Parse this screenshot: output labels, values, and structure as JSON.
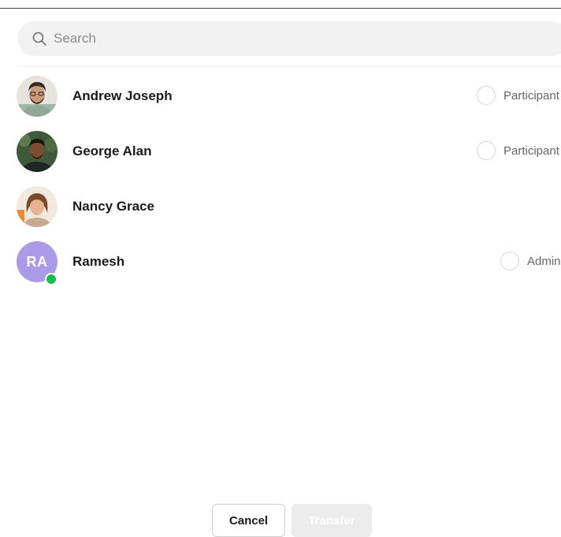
{
  "search": {
    "placeholder": "Search",
    "value": ""
  },
  "members": [
    {
      "name": "Andrew Joseph",
      "avatar": "photo-andrew",
      "role": "Participant",
      "role_selected": false
    },
    {
      "name": "George Alan",
      "avatar": "photo-george",
      "role": "Participant",
      "role_selected": false
    },
    {
      "name": "Nancy Grace",
      "avatar": "photo-nancy",
      "role": "",
      "role_selected": false
    },
    {
      "name": "Ramesh",
      "initials": "RA",
      "avatar_color": "#a99be6",
      "online": true,
      "role": "Admin",
      "role_selected": false
    }
  ],
  "footer": {
    "cancel_label": "Cancel",
    "transfer_label": "Transfer",
    "transfer_enabled": false
  },
  "colors": {
    "presence_online": "#1db954",
    "initials_avatar": "#a99be6",
    "search_bg": "#f2f2f2",
    "transfer_disabled_bg": "#ececec"
  },
  "icons": {
    "search": "search-icon"
  }
}
